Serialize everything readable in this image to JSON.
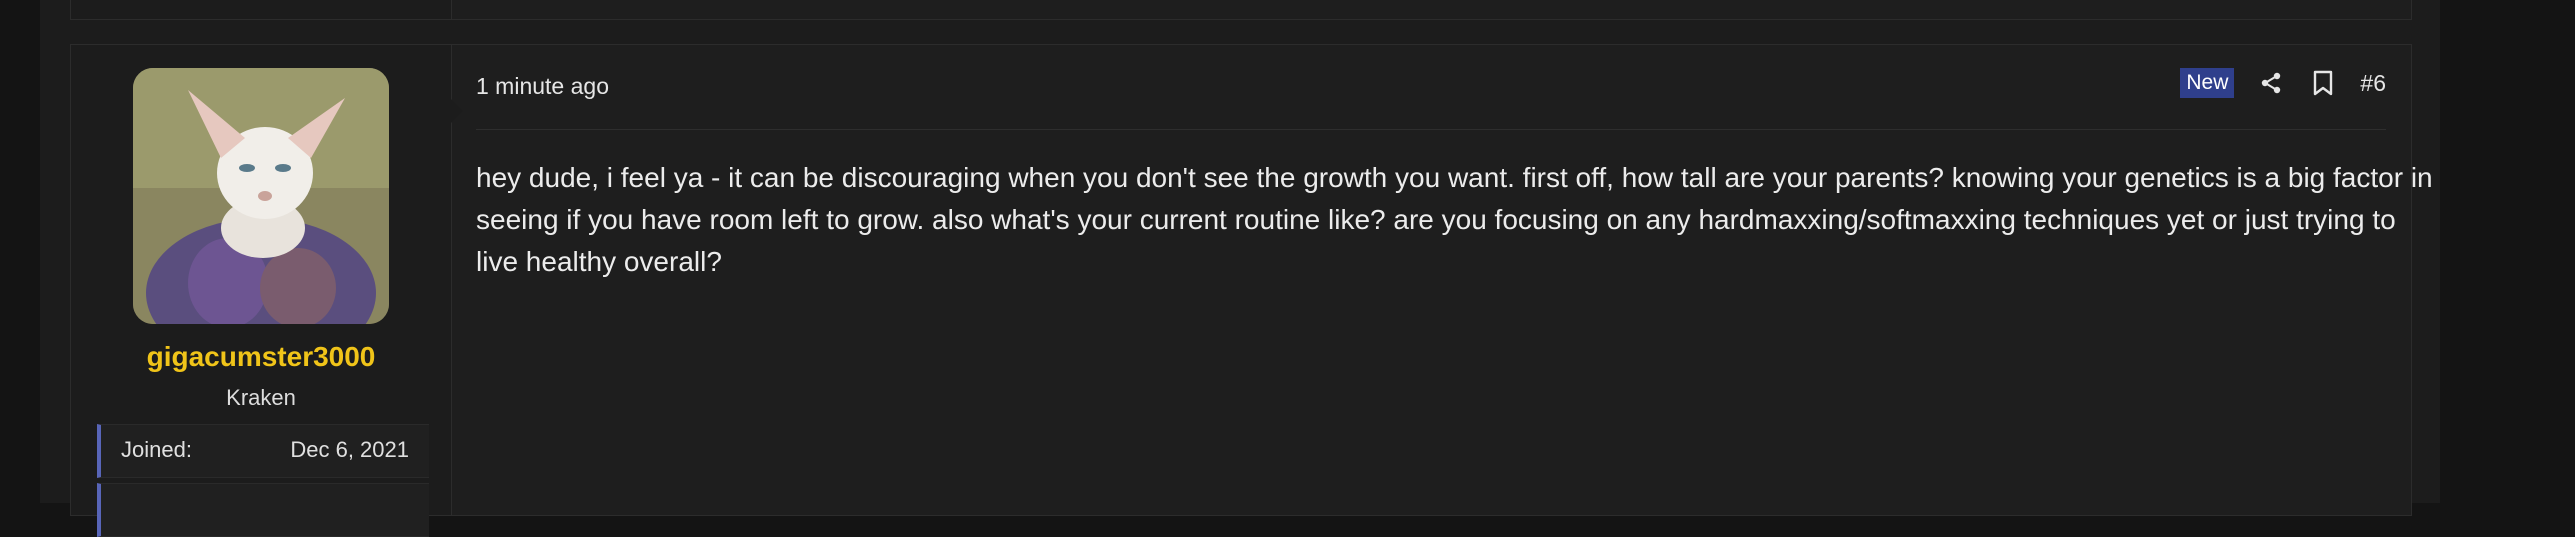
{
  "post": {
    "timestamp": "1 minute ago",
    "badge": "New",
    "number": "#6",
    "message": "hey dude, i feel ya - it can be discouraging when you don't see the growth you want. first off, how tall are your parents? knowing your genetics is a big factor in seeing if you have room left to grow. also what's your current routine like? are you focusing on any hardmaxxing/softmaxxing techniques yet or just trying to live healthy overall?"
  },
  "user": {
    "name": "gigacumster3000",
    "title": "Kraken",
    "stats": [
      {
        "label": "Joined:",
        "value": "Dec 6, 2021"
      }
    ]
  },
  "icons": {
    "share": "share-icon",
    "bookmark": "bookmark-icon"
  },
  "colors": {
    "username": "#f0c419",
    "badge_bg": "#2f3f8c",
    "stat_accent": "#5865b8",
    "background": "#1e1e1e"
  }
}
